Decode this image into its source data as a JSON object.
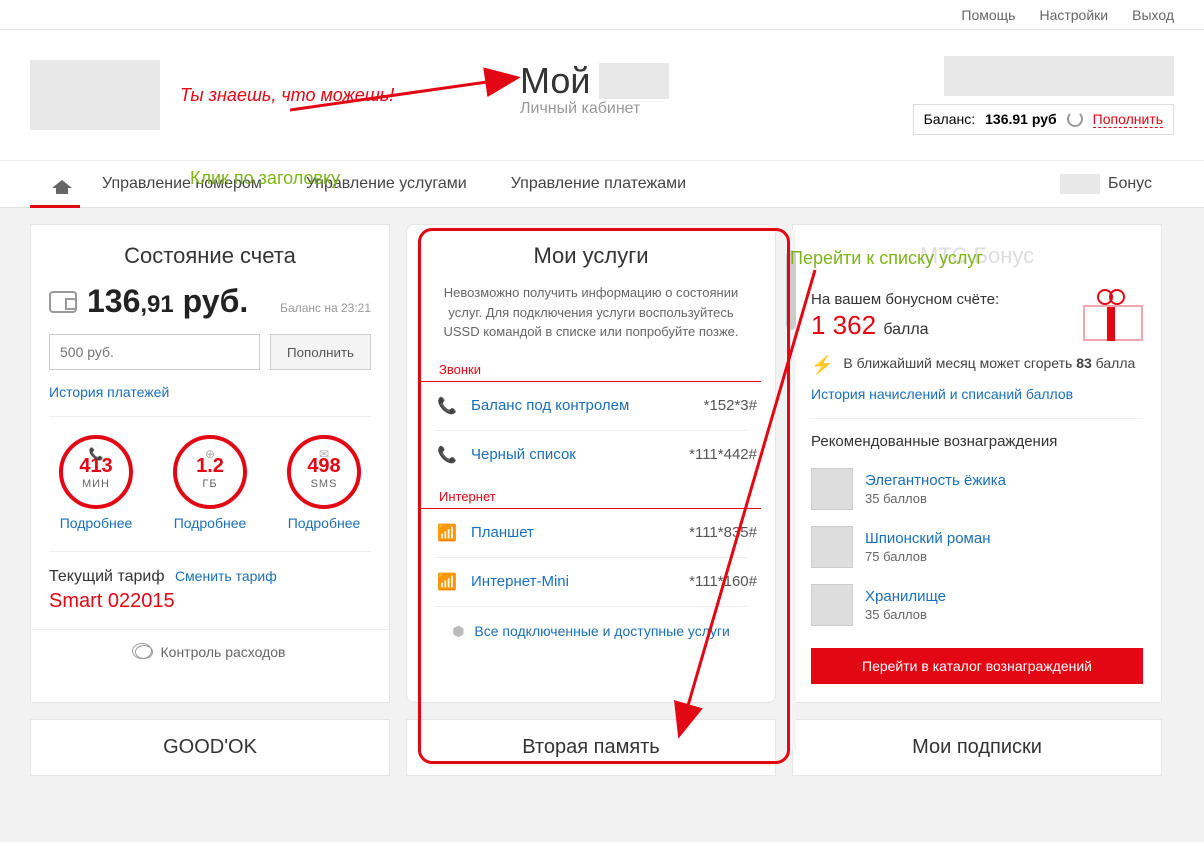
{
  "topnav": {
    "help": "Помощь",
    "settings": "Настройки",
    "logout": "Выход"
  },
  "header": {
    "slogan": "Ты знаешь, что можешь!",
    "brand_title": "Мой",
    "brand_sub": "Личный кабинет",
    "balance_label": "Баланс:",
    "balance_value": "136.91",
    "balance_currency": "руб",
    "topup": "Пополнить"
  },
  "nav": {
    "num": "Управление номером",
    "svc": "Управление услугами",
    "pay": "Управление платежами",
    "bonus": "Бонус"
  },
  "account": {
    "title": "Состояние счета",
    "amount_rub": "136",
    "amount_kop": ",91",
    "currency": "руб.",
    "balance_time": "Баланс на 23:21",
    "topup_placeholder": "500 руб.",
    "topup_btn": "Пополнить",
    "history": "История платежей",
    "usage": [
      {
        "val": "413",
        "unit": "МИН",
        "icon": "📞",
        "more": "Подробнее"
      },
      {
        "val": "1.2",
        "unit": "ГБ",
        "icon": "⊕",
        "more": "Подробнее"
      },
      {
        "val": "498",
        "unit": "SMS",
        "icon": "✉",
        "more": "Подробнее"
      }
    ],
    "tariff_label": "Текущий тариф",
    "tariff_change": "Сменить тариф",
    "tariff_name": "Smart 022015",
    "expenses": "Контроль расходов"
  },
  "services": {
    "title": "Мои услуги",
    "msg": "Невозможно получить информацию о состоянии услуг. Для подключения услуги воспользуйтесь USSD командой в списке или попробуйте позже.",
    "sec_calls": "Звонки",
    "sec_internet": "Интернет",
    "items_calls": [
      {
        "name": "Баланс под контролем",
        "code": "*152*3#"
      },
      {
        "name": "Черный список",
        "code": "*111*442#"
      }
    ],
    "items_net": [
      {
        "name": "Планшет",
        "code": "*111*835#"
      },
      {
        "name": "Интернет-Mini",
        "code": "*111*160#"
      }
    ],
    "all": "Все подключенные и доступные услуги"
  },
  "bonus": {
    "faded_title": "МТС Бонус",
    "label": "На вашем бонусном счёте:",
    "amount": "1 362",
    "unit": "балла",
    "warn_pre": "В ближайший месяц может сгореть ",
    "warn_b": "83",
    "warn_post": " балла",
    "history": "История начислений и списаний баллов",
    "rec_title": "Рекомендованные вознаграждения",
    "recs": [
      {
        "name": "Элегантность ёжика",
        "price": "35 баллов"
      },
      {
        "name": "Шпионский роман",
        "price": "75 баллов"
      },
      {
        "name": "Хранилище",
        "price": "35 баллов"
      }
    ],
    "catalog": "Перейти в каталог вознаграждений"
  },
  "bottom": {
    "c1": "GOOD'OK",
    "c2": "Вторая память",
    "c3": "Мои подписки"
  },
  "annotations": {
    "click_title": "Клик по заголовку",
    "go_services": "Перейти к списку услуг"
  }
}
